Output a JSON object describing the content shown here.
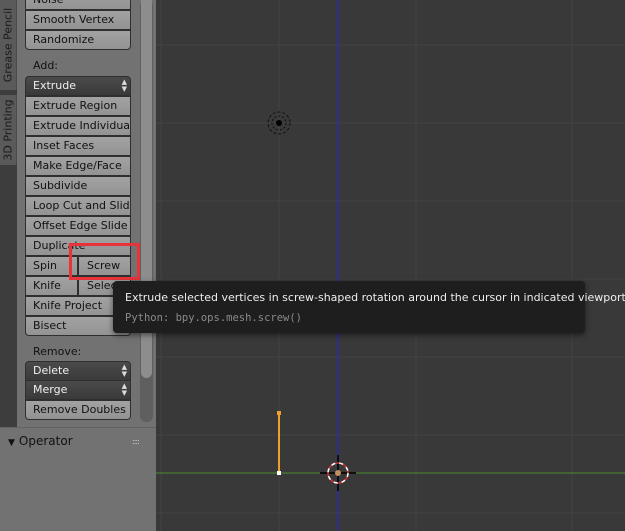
{
  "tabs": [
    {
      "label": "Grease Pencil"
    },
    {
      "label": "3D Printing"
    }
  ],
  "shelf": {
    "top_buttons": [
      "Noise",
      "Smooth Vertex",
      "Randomize"
    ],
    "add_label": "Add:",
    "add_dropdown": "Extrude",
    "add_buttons": [
      "Extrude Region",
      "Extrude Individual",
      "Inset Faces",
      "Make Edge/Face",
      "Subdivide",
      "Loop Cut and Slide",
      "Offset Edge Slide",
      "Duplicate"
    ],
    "spin": "Spin",
    "screw": "Screw",
    "knife": "Knife",
    "select": "Select",
    "knife_project": "Knife Project",
    "bisect": "Bisect",
    "remove_label": "Remove:",
    "delete_dropdown": "Delete",
    "merge_dropdown": "Merge",
    "remove_doubles": "Remove Doubles"
  },
  "operator": {
    "title": "Operator"
  },
  "tooltip": {
    "description": "Extrude selected vertices in screw-shaped rotation around the cursor in indicated viewport",
    "python": "Python: bpy.ops.mesh.screw()"
  },
  "colors": {
    "highlight": "#e8333a",
    "x_axis": "#4a8a2a",
    "z_axis": "#2a2ab0",
    "edge_selected": "#f0a030"
  }
}
